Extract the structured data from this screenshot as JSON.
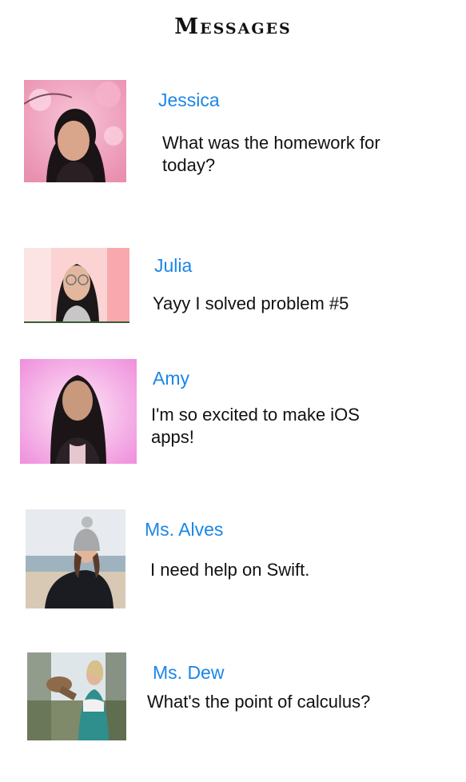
{
  "header": {
    "title": "Messages"
  },
  "messages": [
    {
      "name": "Jessica",
      "text": "What was the homework for today?",
      "avatar": "avatar-photo-pink-blossom"
    },
    {
      "name": "Julia",
      "text": "Yayy I solved problem #5",
      "avatar": "avatar-photo-pink-wall"
    },
    {
      "name": "Amy",
      "text": "I'm so excited to make iOS apps!",
      "avatar": "avatar-photo-pink-gradient"
    },
    {
      "name": "Ms. Alves",
      "text": "I need help on Swift.",
      "avatar": "avatar-photo-beach"
    },
    {
      "name": "Ms. Dew",
      "text": "What's the point of calculus?",
      "avatar": "avatar-photo-outdoors-dog"
    }
  ],
  "colors": {
    "name_link": "#1a86e8",
    "text": "#111111",
    "background": "#ffffff"
  }
}
